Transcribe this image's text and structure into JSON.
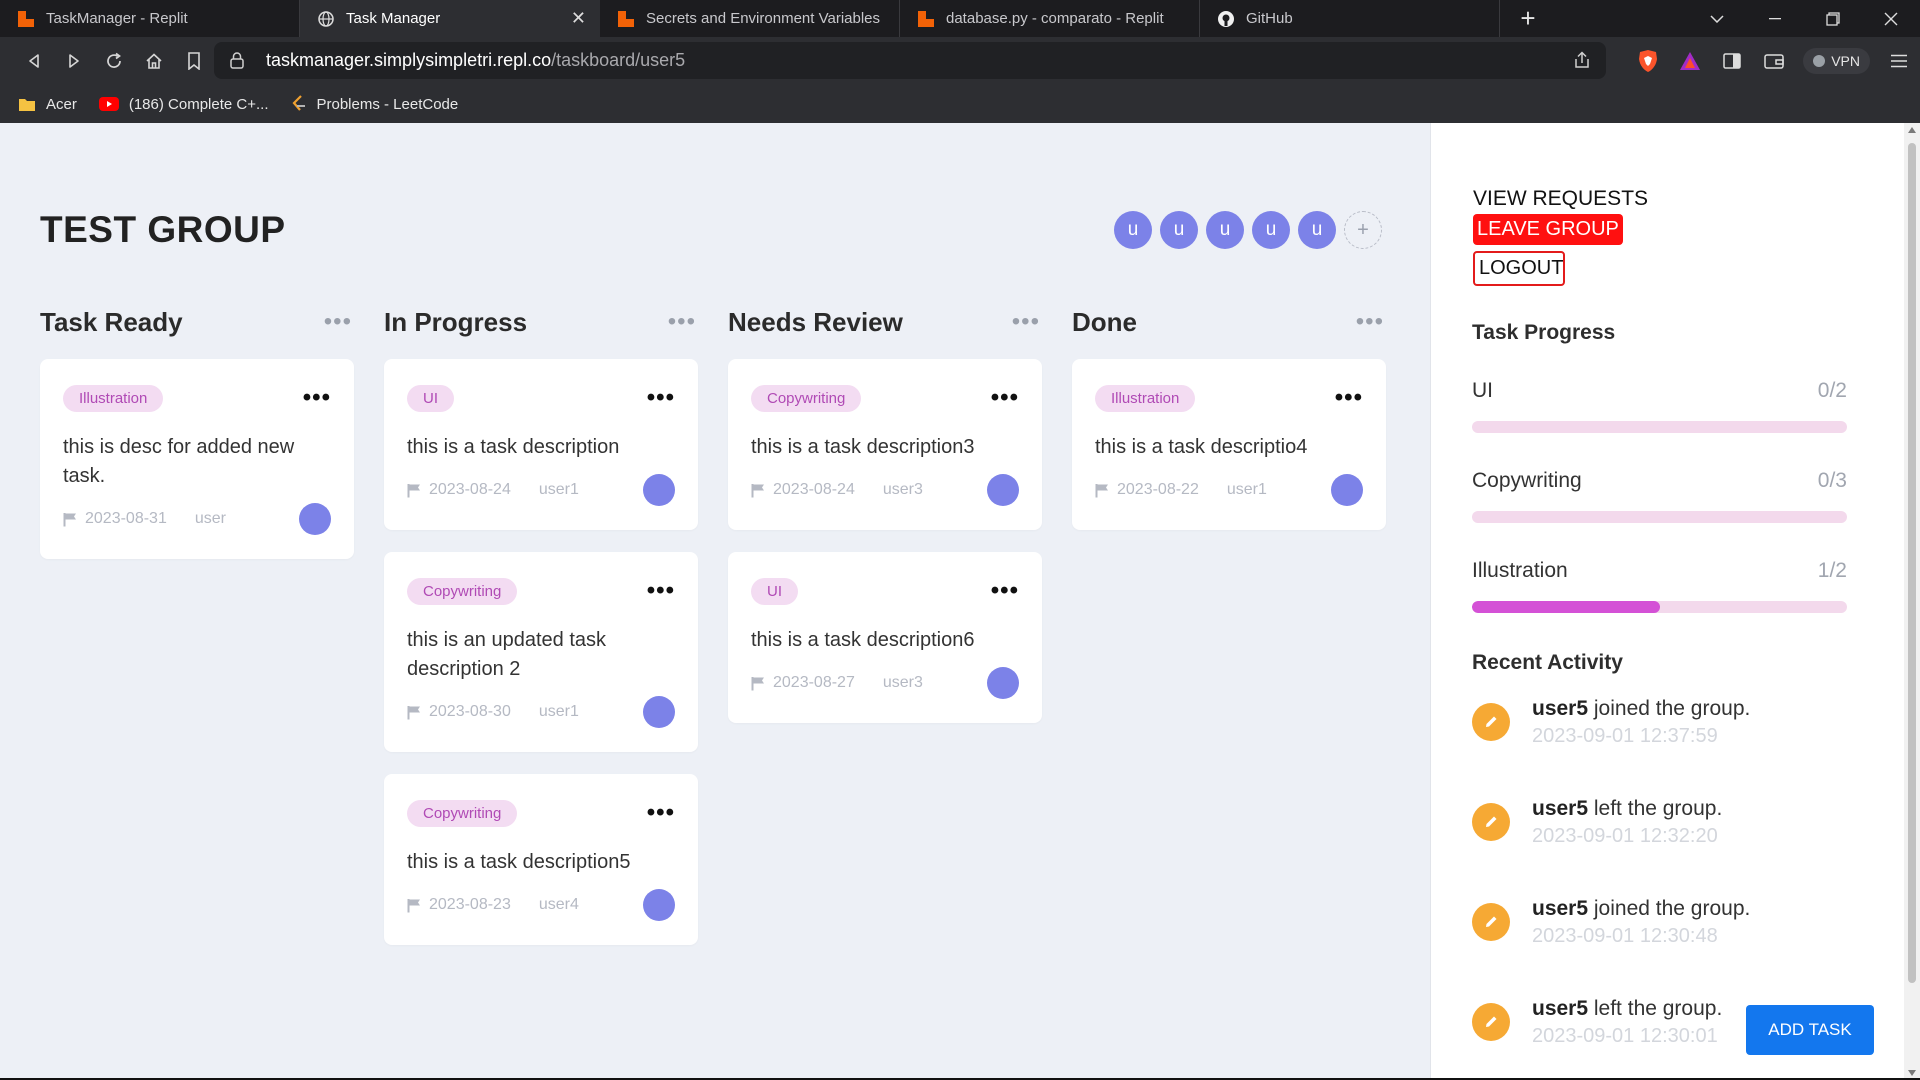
{
  "browser": {
    "tabs": [
      {
        "title": "TaskManager - Replit",
        "favicon": "replit-icon",
        "active": false
      },
      {
        "title": "Task Manager",
        "favicon": "globe-icon",
        "active": true
      },
      {
        "title": "Secrets and Environment Variables | Re",
        "favicon": "replit-icon",
        "active": false
      },
      {
        "title": "database.py - comparato - Replit",
        "favicon": "replit-icon",
        "active": false
      },
      {
        "title": "GitHub",
        "favicon": "github-icon",
        "active": false
      }
    ],
    "tab_close_glyph": "✕",
    "new_tab_glyph": "+",
    "url_host": "taskmanager.simplysimpletri.repl.co",
    "url_path": "/taskboard/user5",
    "vpn_label": "VPN",
    "bookmarks": [
      {
        "label": "Acer",
        "icon": "folder-icon"
      },
      {
        "label": "(186) Complete C+...",
        "icon": "youtube-icon"
      },
      {
        "label": "Problems - LeetCode",
        "icon": "leetcode-icon"
      }
    ]
  },
  "board": {
    "group_title": "TEST GROUP",
    "members": [
      "u",
      "u",
      "u",
      "u",
      "u"
    ],
    "add_member_glyph": "+",
    "column_menu_glyph": "•••",
    "card_menu_glyph": "•••",
    "columns": [
      {
        "title": "Task Ready",
        "cards": [
          {
            "tag": "Illustration",
            "desc": "this is desc for added new task.",
            "date": "2023-08-31",
            "user": "user"
          }
        ]
      },
      {
        "title": "In Progress",
        "cards": [
          {
            "tag": "UI",
            "desc": "this is a task description",
            "date": "2023-08-24",
            "user": "user1"
          },
          {
            "tag": "Copywriting",
            "desc": "this is an updated task description 2",
            "date": "2023-08-30",
            "user": "user1"
          },
          {
            "tag": "Copywriting",
            "desc": "this is a task description5",
            "date": "2023-08-23",
            "user": "user4"
          }
        ]
      },
      {
        "title": "Needs Review",
        "cards": [
          {
            "tag": "Copywriting",
            "desc": "this is a task description3",
            "date": "2023-08-24",
            "user": "user3"
          },
          {
            "tag": "UI",
            "desc": "this is a task description6",
            "date": "2023-08-27",
            "user": "user3"
          }
        ]
      },
      {
        "title": "Done",
        "cards": [
          {
            "tag": "Illustration",
            "desc": "this is a task descriptio4",
            "date": "2023-08-22",
            "user": "user1"
          }
        ]
      }
    ]
  },
  "side": {
    "view_requests": "VIEW REQUESTS",
    "leave_group": "LEAVE GROUP",
    "logout": "LOGOUT",
    "task_progress_heading": "Task Progress",
    "progress": [
      {
        "name": "UI",
        "count": "0/2",
        "fraction": 0
      },
      {
        "name": "Copywriting",
        "count": "0/3",
        "fraction": 0
      },
      {
        "name": "Illustration",
        "count": "1/2",
        "fraction": 0.5
      }
    ],
    "recent_activity_heading": "Recent Activity",
    "activity": [
      {
        "user": "user5",
        "action": " joined the group.",
        "time": "2023-09-01 12:37:59"
      },
      {
        "user": "user5",
        "action": " left the group.",
        "time": "2023-09-01 12:32:20"
      },
      {
        "user": "user5",
        "action": " joined the group.",
        "time": "2023-09-01 12:30:48"
      },
      {
        "user": "user5",
        "action": " left the group.",
        "time": "2023-09-01 12:30:01"
      }
    ],
    "add_task": "ADD TASK"
  },
  "colors": {
    "accent_blue": "#1377ee",
    "avatar": "#7c82e8",
    "tag_bg": "#f3dcf2",
    "tag_text": "#b04ab5",
    "danger": "#ff1010",
    "activity_icon": "#f6a934",
    "progress_fill": "#d451d6",
    "progress_track": "#f3d9ec"
  }
}
